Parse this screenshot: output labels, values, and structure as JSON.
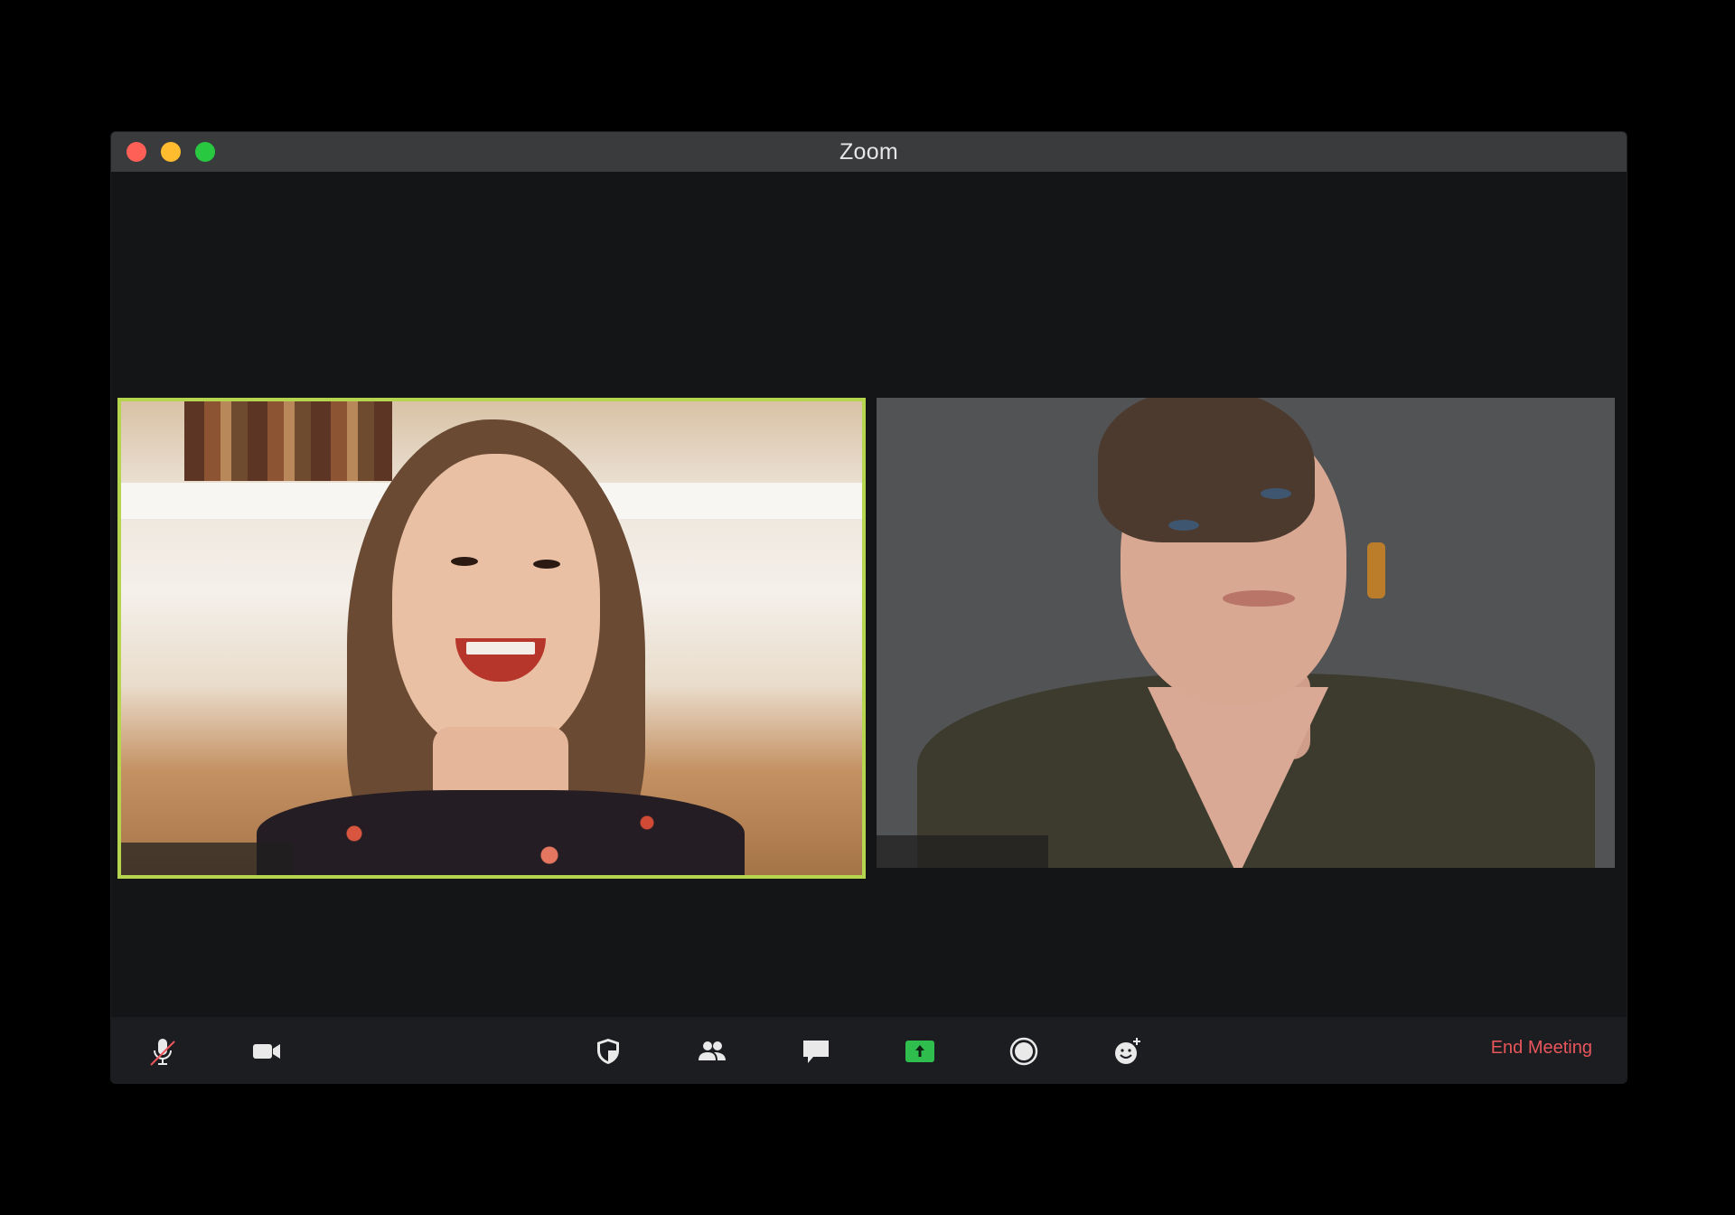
{
  "window": {
    "title": "Zoom",
    "accent_active_speaker": "#b6d54e"
  },
  "participants": [
    {
      "tile": "left",
      "active_speaker": true
    },
    {
      "tile": "right",
      "active_speaker": false
    }
  ],
  "toolbar": {
    "icons": [
      "microphone-muted-icon",
      "video-camera-icon",
      "shield-icon",
      "participants-icon",
      "chat-icon",
      "share-screen-icon",
      "record-icon",
      "reactions-icon"
    ],
    "end_meeting_label": "End Meeting",
    "end_meeting_color": "#e8565c",
    "share_color": "#2fbe4d"
  }
}
